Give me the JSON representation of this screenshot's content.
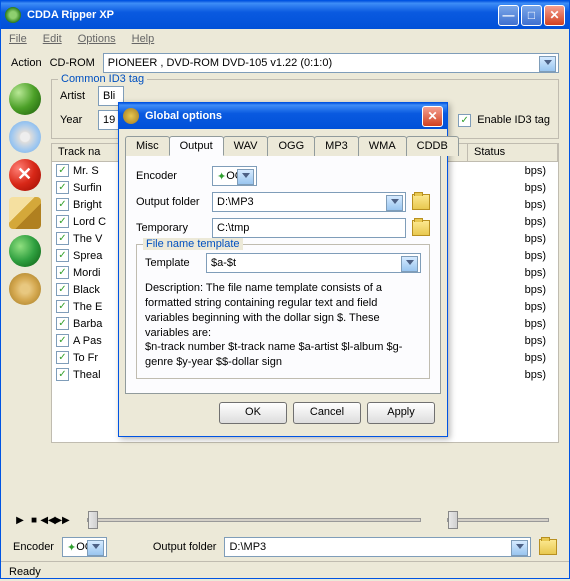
{
  "window": {
    "title": "CDDA Ripper XP"
  },
  "menu": {
    "file": "File",
    "edit": "Edit",
    "options": "Options",
    "help": "Help"
  },
  "action": {
    "label": "Action",
    "drive_label": "CD-ROM",
    "drive_value": "PIONEER , DVD-ROM DVD-105  v1.22 (0:1:0)"
  },
  "id3": {
    "legend": "Common ID3 tag",
    "artist_label": "Artist",
    "artist_value": "Bli",
    "year_label": "Year",
    "year_value": "19",
    "enable_label": "Enable ID3 tag"
  },
  "tracks": {
    "header_name": "Track na",
    "header_status": "Status",
    "list": [
      {
        "name": "Mr. S",
        "bps": "bps)"
      },
      {
        "name": "Surfin",
        "bps": "bps)"
      },
      {
        "name": "Bright",
        "bps": "bps)"
      },
      {
        "name": "Lord C",
        "bps": "bps)"
      },
      {
        "name": "The V",
        "bps": "bps)"
      },
      {
        "name": "Sprea",
        "bps": "bps)"
      },
      {
        "name": "Mordi",
        "bps": "bps)"
      },
      {
        "name": "Black",
        "bps": "bps)"
      },
      {
        "name": "The E",
        "bps": "bps)"
      },
      {
        "name": "Barba",
        "bps": "bps)"
      },
      {
        "name": "A Pas",
        "bps": "bps)"
      },
      {
        "name": "To Fr",
        "bps": "bps)"
      },
      {
        "name": "Theal",
        "bps": "bps)"
      }
    ]
  },
  "bottom": {
    "encoder_label": "Encoder",
    "encoder_value": "OGG",
    "output_label": "Output folder",
    "output_value": "D:\\MP3"
  },
  "status": "Ready",
  "modal": {
    "title": "Global options",
    "tabs": {
      "misc": "Misc",
      "output": "Output",
      "wav": "WAV",
      "ogg": "OGG",
      "mp3": "MP3",
      "wma": "WMA",
      "cddb": "CDDB"
    },
    "encoder_label": "Encoder",
    "encoder_value": "OGG",
    "output_label": "Output folder",
    "output_value": "D:\\MP3",
    "temp_label": "Temporary",
    "temp_value": "C:\\tmp",
    "template_legend": "File name template",
    "template_label": "Template",
    "template_value": "$a-$t",
    "desc": "Description: The file name template consists of a formatted string containing regular text and field variables beginning with the dollar sign $. These variables are:\n$n-track number $t-track name $a-artist $l-album $g-genre $y-year $$-dollar sign",
    "ok": "OK",
    "cancel": "Cancel",
    "apply": "Apply"
  }
}
